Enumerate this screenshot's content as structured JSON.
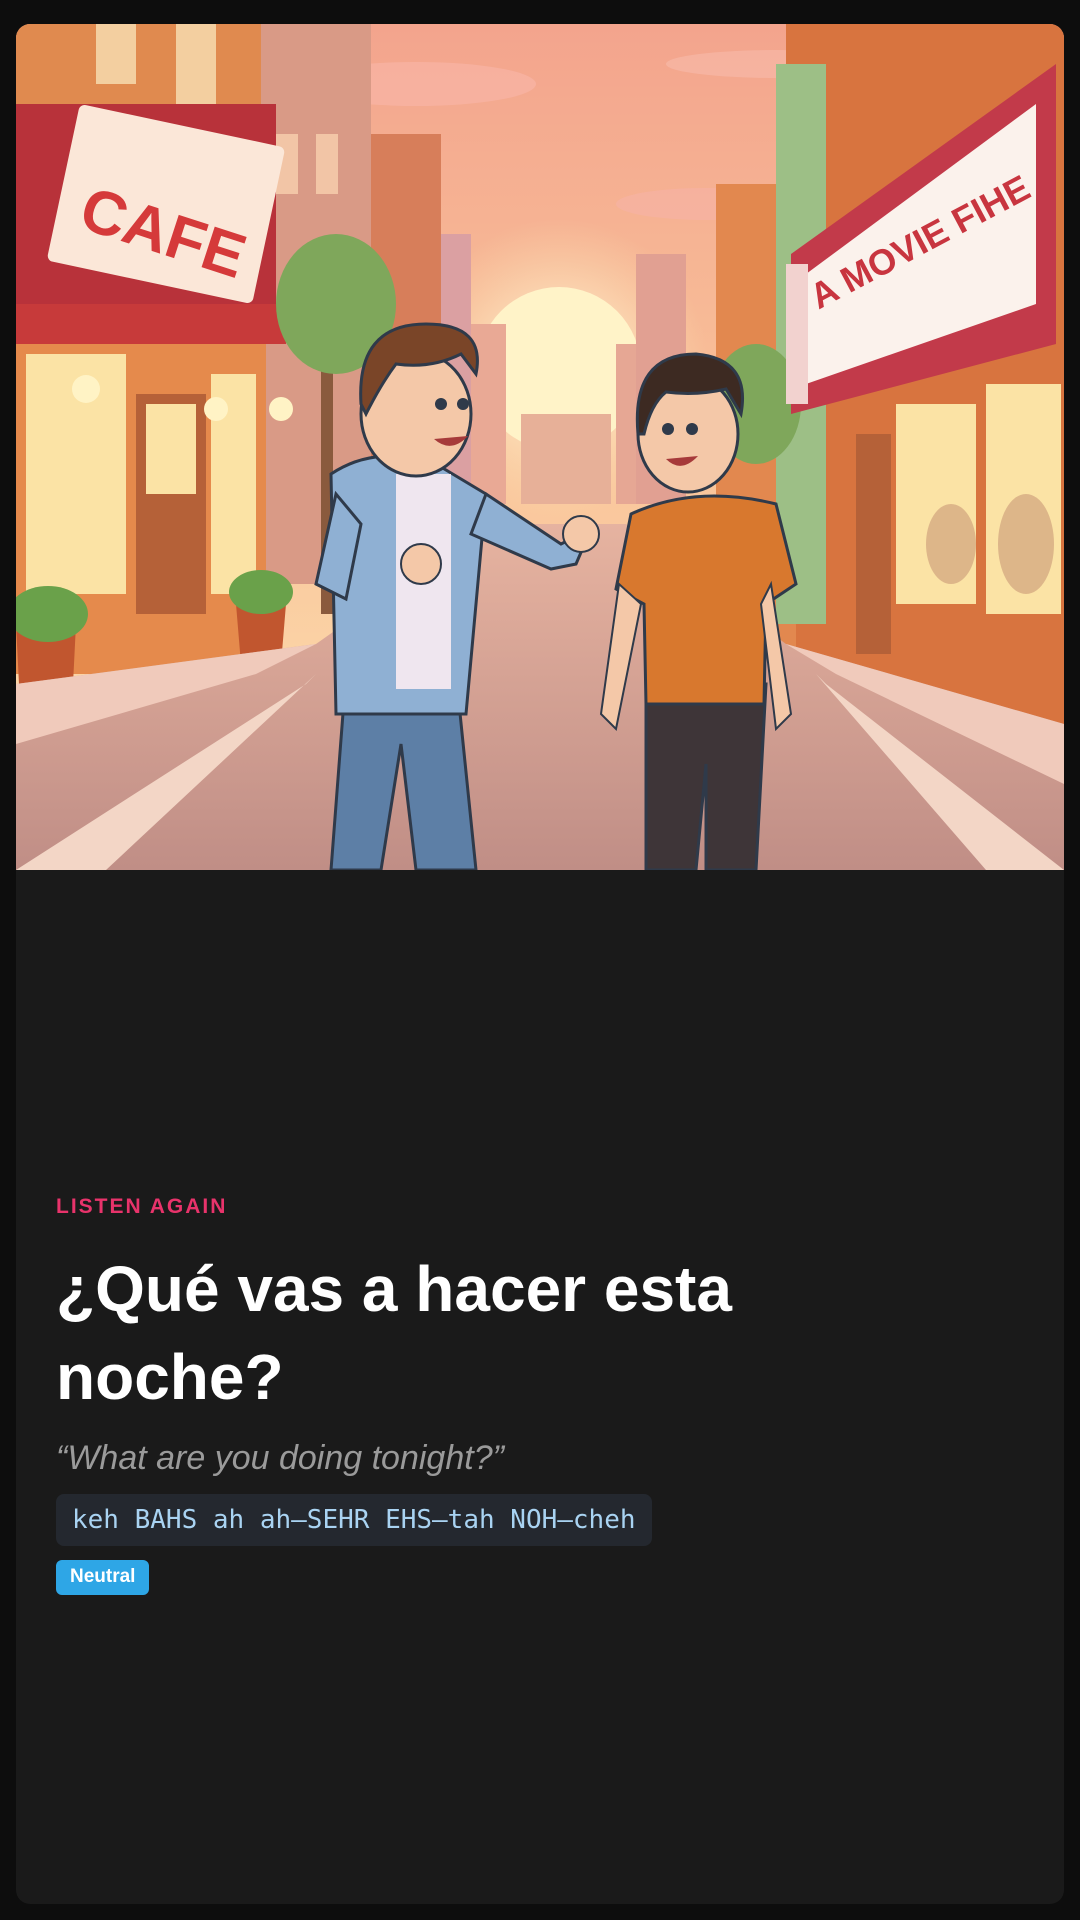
{
  "illustration": {
    "cafe_sign": "CAFE",
    "marquee_sign": "A MOVIE FIHE",
    "palette": {
      "sky_top": "#f3a48d",
      "sky_bottom": "#fcd9a0",
      "sun": "#fff3c8",
      "road": "#c99a8c",
      "cafe_red": "#c73a3a",
      "jacket": "#8fb0d3",
      "jeans": "#5d7fa6",
      "tshirt": "#d8782e",
      "pants": "#3e3538"
    }
  },
  "card": {
    "eyebrow": "LISTEN AGAIN",
    "phrase": "¿Qué vas a hacer esta noche?",
    "translation": "“What are you doing tonight?”",
    "pronunciation": "keh BAHS ah ah–SEHR EHS–tah NOH–cheh",
    "badge": "Neutral"
  },
  "colors": {
    "eyebrow": "#e8336b",
    "badge_bg": "#2ea6e6",
    "pronunciation_text": "#a9d3f2",
    "background": "#1a1a1a"
  }
}
